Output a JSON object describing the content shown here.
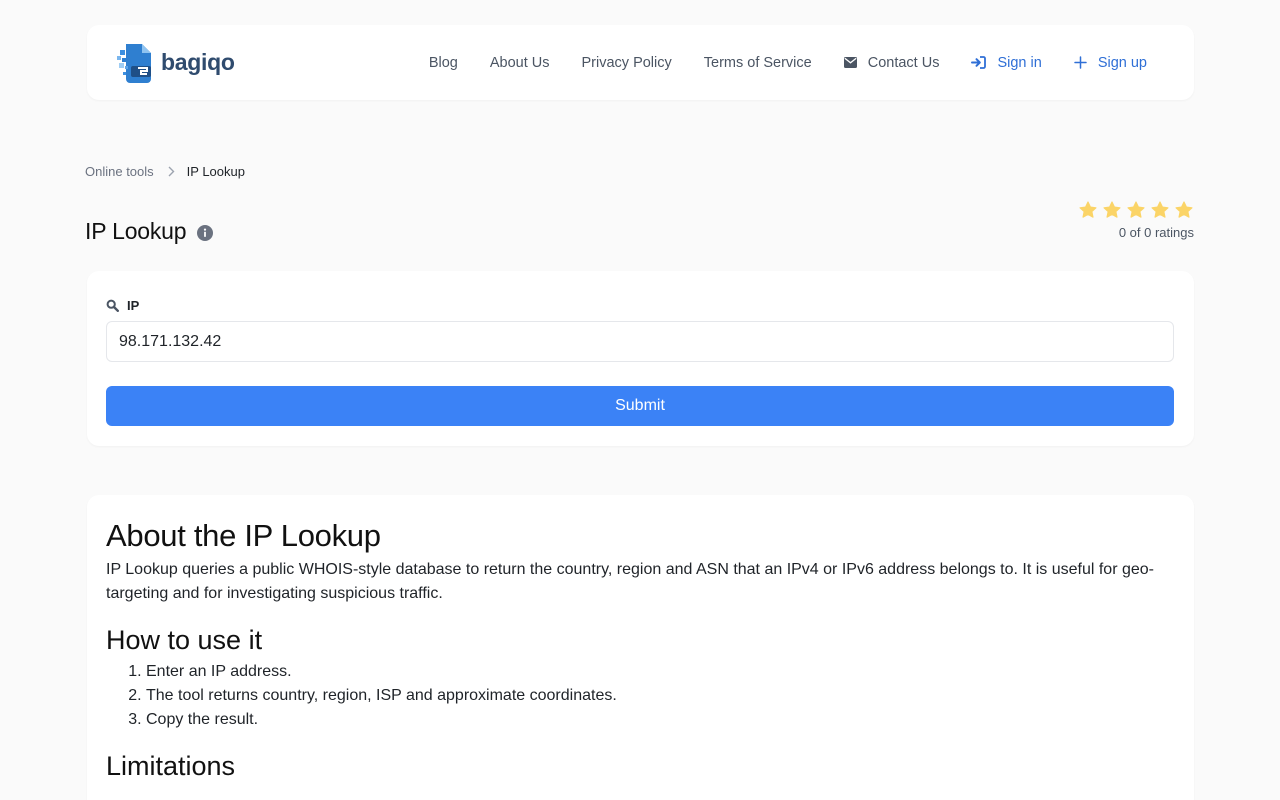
{
  "brand": {
    "name": "bagiqo"
  },
  "nav": {
    "blog": "Blog",
    "about": "About Us",
    "privacy": "Privacy Policy",
    "terms": "Terms of Service",
    "contact": "Contact Us",
    "signin": "Sign in",
    "signup": "Sign up"
  },
  "breadcrumb": {
    "parent": "Online tools",
    "current": "IP Lookup"
  },
  "page": {
    "title": "IP Lookup"
  },
  "rating": {
    "stars_filled": 0,
    "stars_total": 5,
    "text": "0 of 0 ratings",
    "star_color": "#fbd467"
  },
  "form": {
    "label": "IP",
    "value": "98.171.132.42",
    "submit": "Submit"
  },
  "about": {
    "heading": "About the IP Lookup",
    "description": "IP Lookup queries a public WHOIS-style database to return the country, region and ASN that an IPv4 or IPv6 address belongs to. It is useful for geo-targeting and for investigating suspicious traffic.",
    "how_heading": "How to use it",
    "steps": [
      "Enter an IP address.",
      "The tool returns country, region, ISP and approximate coordinates.",
      "Copy the result."
    ],
    "limitations_heading": "Limitations"
  },
  "colors": {
    "accent": "#3b82f6",
    "link_accent": "#2f6fd6",
    "brand_text": "#2f4b6e"
  }
}
